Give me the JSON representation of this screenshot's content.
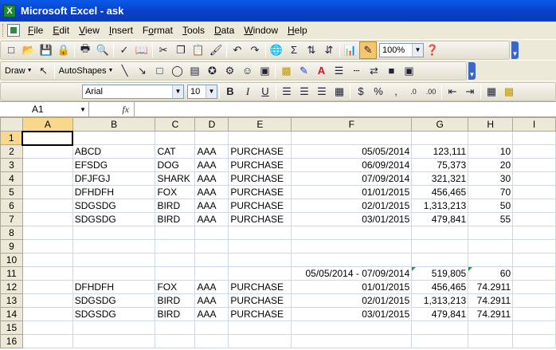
{
  "window": {
    "title": "Microsoft Excel - ask"
  },
  "menu": [
    "File",
    "Edit",
    "View",
    "Insert",
    "Format",
    "Tools",
    "Data",
    "Window",
    "Help"
  ],
  "menu_underline": [
    "F",
    "E",
    "V",
    "I",
    "o",
    "T",
    "D",
    "W",
    "H"
  ],
  "toolbar": {
    "zoom": "100%",
    "draw_label": "Draw",
    "autoshapes_label": "AutoShapes",
    "font_name": "Arial",
    "font_size": "10",
    "bold": "B",
    "italic": "I",
    "underline": "U",
    "currency": "$",
    "percent": "%",
    "comma": ","
  },
  "formula_bar": {
    "name_box": "A1",
    "fx": "fx",
    "content": ""
  },
  "columns": [
    "A",
    "B",
    "C",
    "D",
    "E",
    "F",
    "G",
    "H",
    "I"
  ],
  "rows": [
    {
      "n": "1",
      "cells": [
        "",
        "",
        "",
        "",
        "",
        "",
        "",
        "",
        ""
      ]
    },
    {
      "n": "2",
      "cells": [
        "",
        "ABCD",
        "CAT",
        "AAA",
        "PURCHASE",
        "05/05/2014",
        "123,111",
        "10",
        ""
      ]
    },
    {
      "n": "3",
      "cells": [
        "",
        "EFSDG",
        "DOG",
        "AAA",
        "PURCHASE",
        "06/09/2014",
        "75,373",
        "20",
        ""
      ]
    },
    {
      "n": "4",
      "cells": [
        "",
        "DFJFGJ",
        "SHARK",
        "AAA",
        "PURCHASE",
        "07/09/2014",
        "321,321",
        "30",
        ""
      ]
    },
    {
      "n": "5",
      "cells": [
        "",
        "DFHDFH",
        "FOX",
        "AAA",
        "PURCHASE",
        "01/01/2015",
        "456,465",
        "70",
        ""
      ]
    },
    {
      "n": "6",
      "cells": [
        "",
        "SDGSDG",
        "BIRD",
        "AAA",
        "PURCHASE",
        "02/01/2015",
        "1,313,213",
        "50",
        ""
      ]
    },
    {
      "n": "7",
      "cells": [
        "",
        "SDGSDG",
        "BIRD",
        "AAA",
        "PURCHASE",
        "03/01/2015",
        "479,841",
        "55",
        ""
      ]
    },
    {
      "n": "8",
      "cells": [
        "",
        "",
        "",
        "",
        "",
        "",
        "",
        "",
        ""
      ]
    },
    {
      "n": "9",
      "cells": [
        "",
        "",
        "",
        "",
        "",
        "",
        "",
        "",
        ""
      ]
    },
    {
      "n": "10",
      "cells": [
        "",
        "",
        "",
        "",
        "",
        "",
        "",
        "",
        ""
      ]
    },
    {
      "n": "11",
      "cells": [
        "",
        "",
        "",
        "",
        "",
        "05/05/2014 - 07/09/2014",
        "519,805",
        "60",
        ""
      ]
    },
    {
      "n": "12",
      "cells": [
        "",
        "DFHDFH",
        "FOX",
        "AAA",
        "PURCHASE",
        "01/01/2015",
        "456,465",
        "74.2911",
        ""
      ]
    },
    {
      "n": "13",
      "cells": [
        "",
        "SDGSDG",
        "BIRD",
        "AAA",
        "PURCHASE",
        "02/01/2015",
        "1,313,213",
        "74.2911",
        ""
      ]
    },
    {
      "n": "14",
      "cells": [
        "",
        "SDGSDG",
        "BIRD",
        "AAA",
        "PURCHASE",
        "03/01/2015",
        "479,841",
        "74.2911",
        ""
      ]
    },
    {
      "n": "15",
      "cells": [
        "",
        "",
        "",
        "",
        "",
        "",
        "",
        "",
        ""
      ]
    },
    {
      "n": "16",
      "cells": [
        "",
        "",
        "",
        "",
        "",
        "",
        "",
        "",
        ""
      ]
    }
  ],
  "colors": {
    "title_bar": "#0a4fd8",
    "selection_header": "#f8d88a",
    "error_flag": "#1f9c3a"
  }
}
